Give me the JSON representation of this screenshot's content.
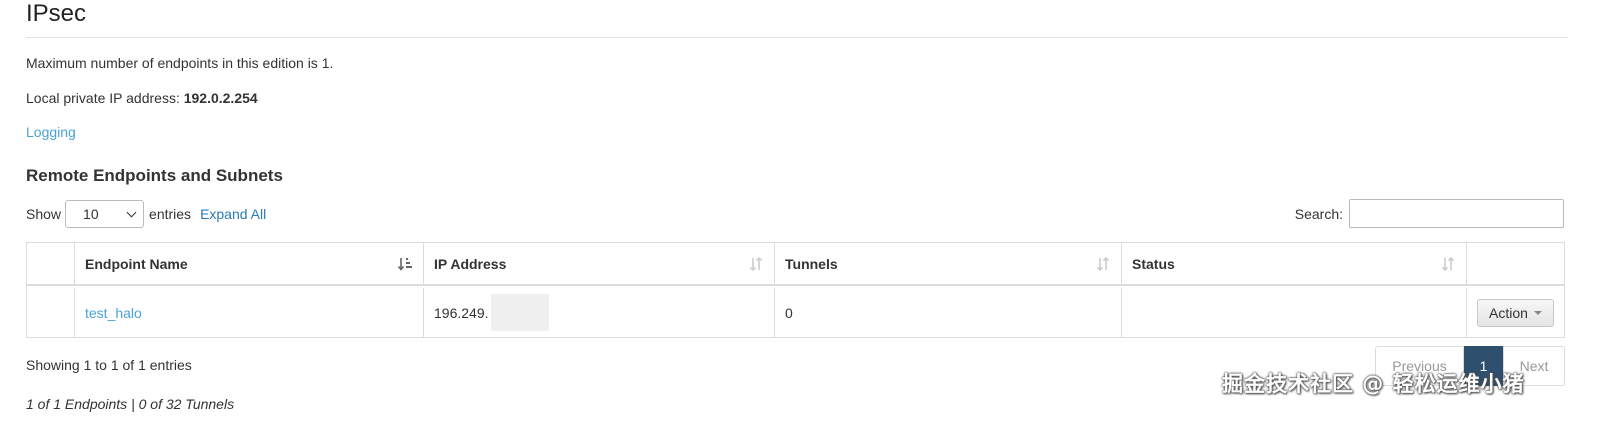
{
  "page": {
    "title": "IPsec",
    "max_endpoints_text": "Maximum number of endpoints in this edition is 1.",
    "local_ip_label": "Local private IP address: ",
    "local_ip_value": "192.0.2.254",
    "logging_link": "Logging"
  },
  "section": {
    "title": "Remote Endpoints and Subnets"
  },
  "controls": {
    "show_label": "Show",
    "page_size": "10",
    "entries_label": "entries",
    "expand_all": "Expand All",
    "search_label": "Search:",
    "search_value": ""
  },
  "table": {
    "columns": [
      "Endpoint Name",
      "IP Address",
      "Tunnels",
      "Status"
    ],
    "rows": [
      {
        "name": "test_halo",
        "ip": "196.249.",
        "tunnels": "0",
        "status": "",
        "action": "Action"
      }
    ]
  },
  "footer": {
    "showing": "Showing 1 to 1 of 1 entries",
    "summary": "1 of 1 Endpoints | 0 of 32 Tunnels",
    "previous": "Previous",
    "current_page": "1",
    "next": "Next"
  },
  "watermark": "掘金技术社区 @ 轻松运维小猪",
  "colors": {
    "link": "#4aa3d6",
    "expand_link": "#2a7ab8",
    "active_page": "#2f4f6f"
  },
  "icons": {
    "sort_active": "sort-alpha-asc-icon",
    "sort_inactive": "sort-both-icon",
    "dropdown": "chevron-down-icon",
    "action_caret": "caret-down-icon"
  }
}
